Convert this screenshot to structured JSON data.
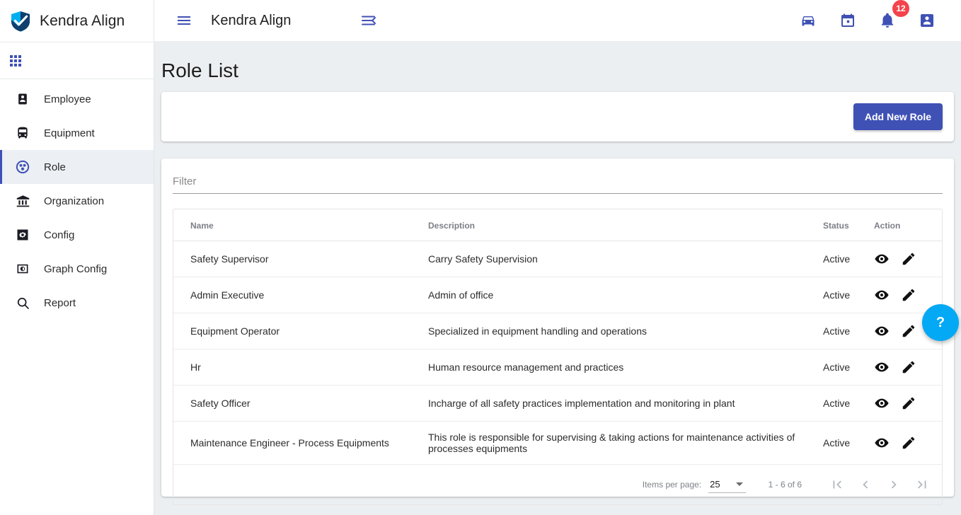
{
  "app": {
    "brand_title": "Kendra Align",
    "header_title": "Kendra Align",
    "logo_icon": "shield-check-icon"
  },
  "sidebar": {
    "apps_icon": "apps-grid-icon",
    "items": [
      {
        "label": "Employee",
        "icon": "person-badge-icon",
        "active": false
      },
      {
        "label": "Equipment",
        "icon": "bus-icon",
        "active": false
      },
      {
        "label": "Role",
        "icon": "role-group-icon",
        "active": true
      },
      {
        "label": "Organization",
        "icon": "bank-icon",
        "active": false
      },
      {
        "label": "Config",
        "icon": "settings-gear-icon",
        "active": false
      },
      {
        "label": "Graph Config",
        "icon": "graph-contrast-icon",
        "active": false
      },
      {
        "label": "Report",
        "icon": "search-icon",
        "active": false
      }
    ]
  },
  "topbar": {
    "menu_icon": "hamburger-menu-icon",
    "collapse_icon": "menu-collapse-icon",
    "icons": [
      {
        "name": "car-icon"
      },
      {
        "name": "calendar-icon"
      },
      {
        "name": "notifications-bell-icon",
        "badge": "12"
      },
      {
        "name": "account-person-icon"
      }
    ]
  },
  "page": {
    "title": "Role List",
    "add_button": "Add New Role"
  },
  "filter": {
    "placeholder": "Filter",
    "value": ""
  },
  "table": {
    "columns": [
      "Name",
      "Description",
      "Status",
      "Action"
    ],
    "rows": [
      {
        "name": "Safety Supervisor",
        "description": "Carry Safety Supervision",
        "status": "Active"
      },
      {
        "name": "Admin Executive",
        "description": "Admin of office",
        "status": "Active"
      },
      {
        "name": "Equipment Operator",
        "description": "Specialized in equipment handling and operations",
        "status": "Active"
      },
      {
        "name": "Hr",
        "description": "Human resource management and practices",
        "status": "Active"
      },
      {
        "name": "Safety Officer",
        "description": "Incharge of all safety practices implementation and monitoring in plant",
        "status": "Active"
      },
      {
        "name": "Maintenance Engineer - Process Equipments",
        "description": "This role is responsible for supervising & taking actions for maintenance activities of processes equipments",
        "status": "Active"
      }
    ],
    "row_actions": [
      {
        "name": "view-icon",
        "title": "View"
      },
      {
        "name": "edit-icon",
        "title": "Edit"
      }
    ]
  },
  "paginator": {
    "items_per_page_label": "Items per page:",
    "items_per_page_value": "25",
    "range_label": "1 - 6 of 6",
    "first_page_icon": "first-page-icon",
    "previous_page_icon": "previous-page-icon",
    "next_page_icon": "next-page-icon",
    "last_page_icon": "last-page-icon"
  },
  "help": {
    "label": "?",
    "icon": "help-question-icon"
  },
  "colors": {
    "primary": "#3f51b5",
    "badge": "#f4434c",
    "help_fab": "#03a9f4",
    "page_bg": "#eceff1",
    "card_bg": "#ffffff"
  }
}
